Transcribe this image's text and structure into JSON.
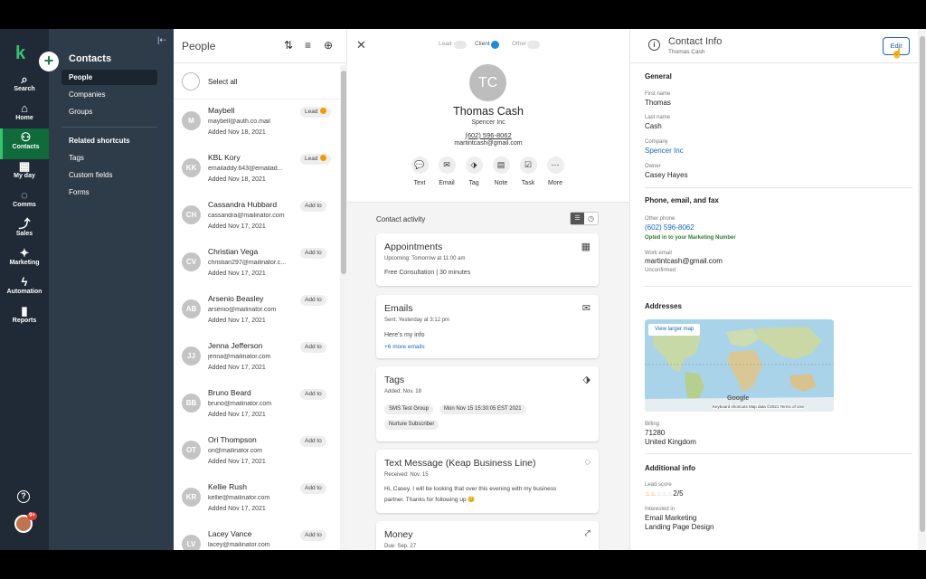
{
  "rail": {
    "items": [
      {
        "label": "Search",
        "icon": "search-icon"
      },
      {
        "label": "Home",
        "icon": "home-icon"
      },
      {
        "label": "Contacts",
        "icon": "contacts-icon"
      },
      {
        "label": "My day",
        "icon": "calendar-icon"
      },
      {
        "label": "Comms",
        "icon": "chat-icon"
      },
      {
        "label": "Sales",
        "icon": "sales-icon"
      },
      {
        "label": "Marketing",
        "icon": "marketing-icon"
      },
      {
        "label": "Automation",
        "icon": "automation-icon"
      },
      {
        "label": "Reports",
        "icon": "reports-icon"
      }
    ],
    "help": "?",
    "avatar_badge": "9+"
  },
  "sidebar": {
    "title": "Contacts",
    "items": [
      "People",
      "Companies",
      "Groups"
    ],
    "shortcuts_title": "Related shortcuts",
    "shortcuts": [
      "Tags",
      "Custom fields",
      "Forms"
    ]
  },
  "people": {
    "title": "People",
    "select_all": "Select all",
    "contacts": [
      {
        "initials": "M",
        "name": "Maybell",
        "email": "maybell@auth.co.mail",
        "added": "Added Nov 18, 2021",
        "tag": "Lead"
      },
      {
        "initials": "KK",
        "name": "KBL Kory",
        "email": "emailaddy.643@emailad...",
        "added": "Added Nov 18, 2021",
        "tag": "Lead"
      },
      {
        "initials": "CH",
        "name": "Cassandra Hubbard",
        "email": "cassandra@mailinator.com",
        "added": "Added Nov 17, 2021",
        "tag": "Add to"
      },
      {
        "initials": "CV",
        "name": "Christian Vega",
        "email": "christian297@mailinator.c...",
        "added": "Added Nov 17, 2021",
        "tag": "Add to"
      },
      {
        "initials": "AB",
        "name": "Arsenio Beasley",
        "email": "arsenio@mailinator.com",
        "added": "Added Nov 17, 2021",
        "tag": "Add to"
      },
      {
        "initials": "JJ",
        "name": "Jenna Jefferson",
        "email": "jenna@mailinator.com",
        "added": "Added Nov 17, 2021",
        "tag": "Add to"
      },
      {
        "initials": "BB",
        "name": "Bruno Beard",
        "email": "bruno@mailinator.com",
        "added": "Added Nov 17, 2021",
        "tag": "Add to"
      },
      {
        "initials": "OT",
        "name": "Ori Thompson",
        "email": "ori@mailinator.com",
        "added": "Added Nov 17, 2021",
        "tag": "Add to"
      },
      {
        "initials": "KR",
        "name": "Kellie Rush",
        "email": "kellie@mailinator.com",
        "added": "Added Nov 17, 2021",
        "tag": "Add to"
      },
      {
        "initials": "LV",
        "name": "Lacey Vance",
        "email": "lacey@mailinator.com",
        "added": "",
        "tag": "Add to"
      }
    ]
  },
  "detail": {
    "stages": [
      "Lead",
      "Client",
      "Other"
    ],
    "active_stage": "Client",
    "initials": "TC",
    "name": "Thomas Cash",
    "company": "Spencer Inc",
    "phone": "(602) 596-8062",
    "email": "martintcash@gmail.com",
    "actions": [
      "Text",
      "Email",
      "Tag",
      "Note",
      "Task",
      "More"
    ],
    "activity_title": "Contact activity",
    "cards": {
      "appointments": {
        "title": "Appointments",
        "sub": "Upcoming: Tomorrow at 11:00 am",
        "body": "Free Consultation | 30 minutes"
      },
      "emails": {
        "title": "Emails",
        "sub": "Sent: Yesterday at 3:12 pm",
        "body": "Here's my info",
        "link": "+6 more emails"
      },
      "tags": {
        "title": "Tags",
        "sub": "Added: Nov. 18",
        "chips": [
          "SMS Test Group",
          "Mon Nov 15 15:30:05 EST 2021",
          "Nurture Subscriber"
        ]
      },
      "text": {
        "title": "Text Message (Keap Business Line)",
        "sub": "Received: Nov. 15",
        "body1": "Hi, Casey. I will be looking that over this evening with my business",
        "body2": "partner. Thanks for following up 😊"
      },
      "money": {
        "title": "Money",
        "sub": "Due: Sep. 27"
      }
    }
  },
  "info": {
    "title": "Contact Info",
    "subtitle": "Thomas Cash",
    "edit": "Edit",
    "general": {
      "heading": "General",
      "first_name_label": "First name",
      "first_name": "Thomas",
      "last_name_label": "Last name",
      "last_name": "Cash",
      "company_label": "Company",
      "company": "Spencer Inc",
      "owner_label": "Owner",
      "owner": "Casey Hayes"
    },
    "phone": {
      "heading": "Phone, email, and fax",
      "other_phone_label": "Other phone",
      "other_phone": "(602) 596-8062",
      "opted_in": "Opted in to your Marketing Number",
      "work_email_label": "Work email",
      "work_email": "martintcash@gmail.com",
      "unconfirmed": "Unconfirmed"
    },
    "addresses": {
      "heading": "Addresses",
      "map_button": "View larger map",
      "map_footer": "Keyboard shortcuts   Map data ©2021   Terms of Use",
      "google": "Google",
      "billing_label": "Billing",
      "postal": "71280",
      "country": "United Kingdom"
    },
    "additional": {
      "heading": "Additional info",
      "lead_score_label": "Lead score",
      "lead_score": "2/5",
      "interested_label": "Interested in",
      "interest1": "Email Marketing",
      "interest2": "Landing Page Design"
    }
  },
  "colors": {
    "rail": "#1f2a36",
    "sidebar": "#2e3b48",
    "accent_green": "#36c46f",
    "link_blue": "#1565c0",
    "lead_dot": "#f59b00"
  }
}
